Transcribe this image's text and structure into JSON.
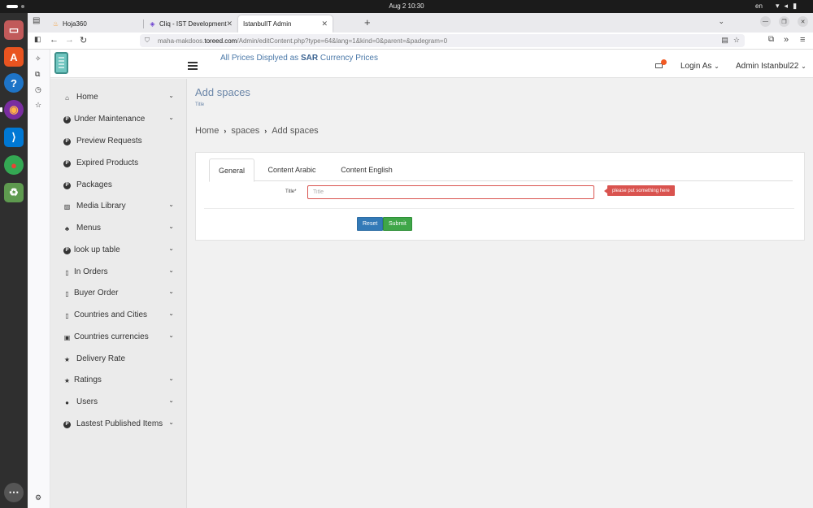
{
  "os": {
    "clock": "Aug 2  10:30",
    "language": "en",
    "dock": [
      {
        "name": "files-icon",
        "color": "#c15a5a",
        "glyph": "▭"
      },
      {
        "name": "app-center-icon",
        "color": "#e95420",
        "glyph": "A"
      },
      {
        "name": "help-icon",
        "color": "#1e74c7",
        "glyph": "?"
      },
      {
        "name": "firefox-icon",
        "color": "#e66000",
        "glyph": "◉"
      },
      {
        "name": "vscode-icon",
        "color": "#0078d4",
        "glyph": "⟩"
      },
      {
        "name": "chrome-icon",
        "color": "#34a853",
        "glyph": "●"
      },
      {
        "name": "trash-icon",
        "color": "#5e9a4f",
        "glyph": "♻"
      },
      {
        "name": "show-apps-icon",
        "color": "#555555",
        "glyph": "⋯"
      }
    ]
  },
  "browser": {
    "tabs": [
      {
        "label": "Hoja360",
        "icon": "flame-icon"
      },
      {
        "label": "Cliq - IST Development",
        "icon": "cliq-icon"
      },
      {
        "label": "IstanbulIT Admin",
        "icon": "none"
      }
    ],
    "url_host": "maha-makdoos.toreed.com",
    "url_path": "/Admin/editContent.php?type=64&lang=1&kind=0&parent=&padegram=0",
    "url_prefix": "maha-makdoos."
  },
  "header": {
    "prices_prefix": "All Prices Displyed as",
    "currency": "SAR",
    "prices_suffix": "Currency Prices",
    "login_as": "Login As",
    "user": "Admin Istanbul22",
    "notification_color": "#f15a24"
  },
  "sidebar": {
    "items": [
      {
        "label": "Home",
        "icon": "home-icon",
        "chevron": true
      },
      {
        "label": "Under Maintenance",
        "icon": "p-badge-icon",
        "chevron": true
      },
      {
        "label": "Preview Requests",
        "icon": "p-badge-icon",
        "chevron": false
      },
      {
        "label": "Expired Products",
        "icon": "p-badge-icon",
        "chevron": false
      },
      {
        "label": "Packages",
        "icon": "p-badge-icon",
        "chevron": false
      },
      {
        "label": "Media Library",
        "icon": "image-icon",
        "chevron": true
      },
      {
        "label": "Menus",
        "icon": "sitemap-icon",
        "chevron": true
      },
      {
        "label": "look up table",
        "icon": "p-badge-icon",
        "chevron": true
      },
      {
        "label": "In Orders",
        "icon": "file-icon",
        "chevron": true
      },
      {
        "label": "Buyer Order",
        "icon": "file-icon",
        "chevron": true
      },
      {
        "label": "Countries and Cities",
        "icon": "file-icon",
        "chevron": true
      },
      {
        "label": "Countries currencies",
        "icon": "money-icon",
        "chevron": true
      },
      {
        "label": "Delivery Rate",
        "icon": "star-icon",
        "chevron": false
      },
      {
        "label": "Ratings",
        "icon": "star-icon",
        "chevron": true
      },
      {
        "label": "Users",
        "icon": "user-icon",
        "chevron": true
      },
      {
        "label": "Lastest Published Items",
        "icon": "p-badge-icon",
        "chevron": true
      }
    ]
  },
  "main": {
    "title": "Add spaces",
    "subtitle": "Title",
    "breadcrumb": [
      "Home",
      "spaces",
      "Add spaces"
    ],
    "tabs": [
      "General",
      "Content Arabic",
      "Content English"
    ],
    "active_tab": "General",
    "form": {
      "title_label": "Title*",
      "title_placeholder": "Title",
      "title_value": "",
      "error": "please put something here",
      "reset_label": "Reset",
      "submit_label": "Submit"
    }
  }
}
